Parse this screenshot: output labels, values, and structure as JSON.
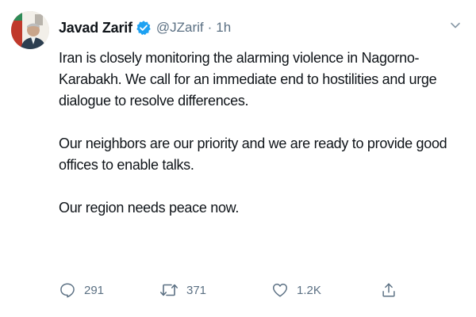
{
  "author": {
    "name": "Javad Zarif",
    "handle": "@JZarif",
    "separator": "·",
    "time": "1h"
  },
  "tweet": {
    "paragraphs": [
      "Iran is closely monitoring the alarming violence in Nagorno-Karabakh. We call for an immediate end to hostilities and urge dialogue to resolve differences.",
      "Our neighbors are our priority and we are ready to provide good offices to enable talks.",
      "Our region needs peace now."
    ]
  },
  "actions": {
    "reply": {
      "icon": "reply-icon",
      "count": "291"
    },
    "retweet": {
      "icon": "retweet-icon",
      "count": "371"
    },
    "like": {
      "icon": "heart-icon",
      "count": "1.2K"
    },
    "share": {
      "icon": "share-icon"
    }
  },
  "colors": {
    "text": "#0f1419",
    "muted": "#5b7083",
    "verified": "#1da1f2"
  }
}
